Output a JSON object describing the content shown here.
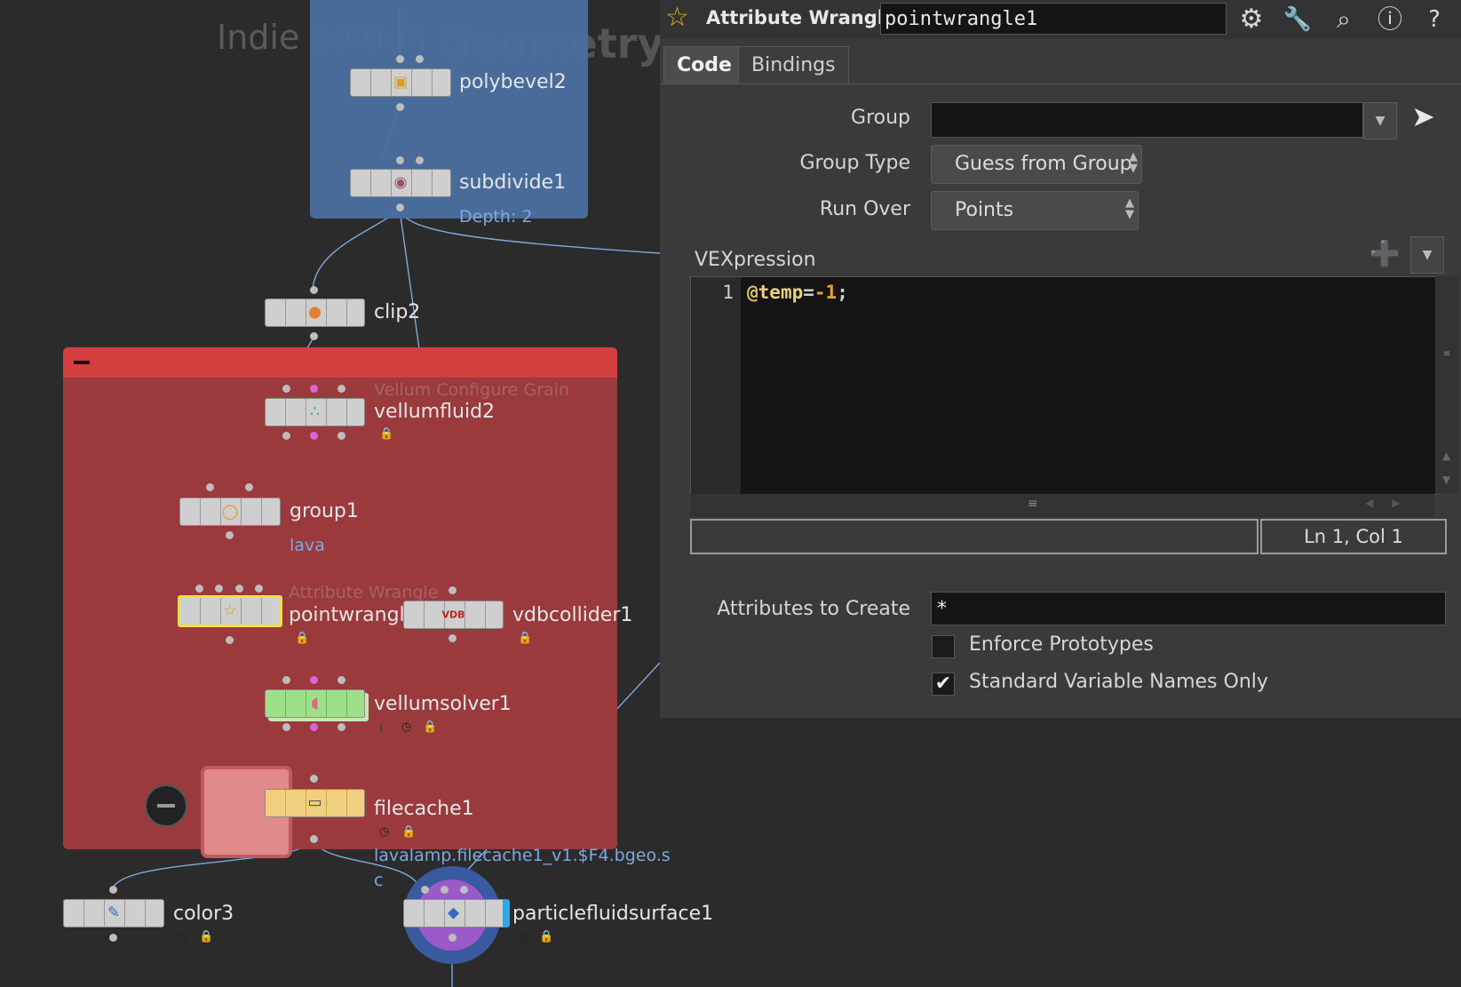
{
  "network": {
    "indie_label": "Indie Edition",
    "context_label": "Geometry",
    "nodes": {
      "polybevel2": {
        "name": "polybevel2"
      },
      "subdivide1": {
        "name": "subdivide1",
        "info": "Depth: 2"
      },
      "clip2": {
        "name": "clip2"
      },
      "vellumfluid2": {
        "name": "vellumfluid2",
        "type": "Vellum Configure Grain"
      },
      "group1": {
        "name": "group1",
        "info": "lava"
      },
      "pointwrangle1": {
        "name": "pointwrangle1",
        "type": "Attribute Wrangle"
      },
      "vdbcollider1": {
        "name": "vdbcollider1",
        "icon_text": "VDB"
      },
      "vellumsolver1": {
        "name": "vellumsolver1"
      },
      "filecache1": {
        "name": "filecache1",
        "info_line1": "lavalamp.filecache1_v1.$F4.bgeo.s",
        "info_line2": "c"
      },
      "color3": {
        "name": "color3"
      },
      "particlefluidsurface1": {
        "name": "particlefluidsurface1"
      }
    },
    "colors": {
      "blue_box": "#4a6fa0",
      "red_box": "#9a3a3c",
      "red_box_header": "#d44040"
    }
  },
  "param_pane": {
    "operator_type": "Attribute Wrangle",
    "node_name": "pointwrangle1",
    "header_icons": [
      "gear-icon",
      "wrench-icon",
      "search-icon",
      "info-icon",
      "help-icon"
    ],
    "tabs": [
      {
        "label": "Code",
        "selected": true
      },
      {
        "label": "Bindings",
        "selected": false
      }
    ],
    "group": {
      "label": "Group",
      "value": ""
    },
    "group_type": {
      "label": "Group Type",
      "value": "Guess from Group"
    },
    "run_over": {
      "label": "Run Over",
      "value": "Points"
    },
    "vexpression": {
      "label": "VEXpression",
      "line_number": "1",
      "code_at": "@",
      "code_attr": "temp",
      "code_op": "=",
      "code_num": "-1",
      "code_end": ";",
      "cursor_status": "Ln 1, Col 1"
    },
    "attributes_to_create": {
      "label": "Attributes to Create",
      "value": "*"
    },
    "enforce_prototypes": {
      "label": "Enforce Prototypes",
      "checked": false
    },
    "standard_variable_names_only": {
      "label": "Standard Variable Names Only",
      "checked": true
    }
  }
}
